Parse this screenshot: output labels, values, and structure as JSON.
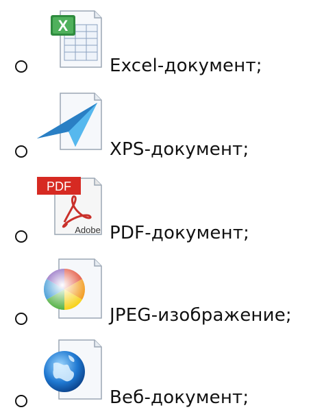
{
  "items": [
    {
      "label": "Excel-документ;",
      "icon": "excel-document-icon"
    },
    {
      "label": "XPS-документ;",
      "icon": "xps-document-icon"
    },
    {
      "label": "PDF-документ;",
      "icon": "pdf-document-icon",
      "icon_text_top": "PDF",
      "icon_text_bottom": "Adobe"
    },
    {
      "label": "JPEG-изображение;",
      "icon": "jpeg-image-icon"
    },
    {
      "label": "Веб-документ;",
      "icon": "web-document-icon"
    }
  ],
  "colors": {
    "excel_green": "#2e8b3e",
    "xps_blue": "#1e90d6",
    "pdf_red": "#d62a22",
    "text": "#111111"
  }
}
